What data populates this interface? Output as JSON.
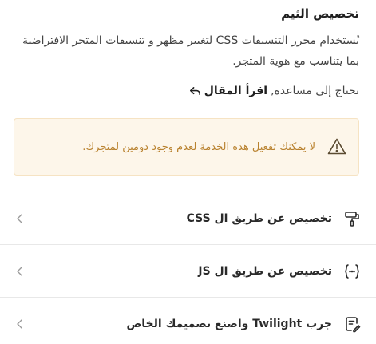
{
  "header": {
    "title": "تخصيص الثيم",
    "description": "يُستخدام محرر التنسيقات CSS لتغيير مظهر و تنسيقات المتجر الافتراضية بما يتناسب مع هوية المتجر."
  },
  "help": {
    "prefix": "تحتاج إلى مساعدة,",
    "link_label": "اقرأ المقال"
  },
  "alert": {
    "message": "لا يمكنك تفعيل هذه الخدمة لعدم وجود دومين لمتجرك."
  },
  "options": [
    {
      "label": "تخصيص عن طريق ال CSS",
      "icon": "paint-roller-icon"
    },
    {
      "label": "تخصيص عن طريق ال JS",
      "icon": "code-braces-icon"
    },
    {
      "label": "جرب Twilight واصنع تصميمك الخاص",
      "icon": "document-design-icon"
    }
  ],
  "colors": {
    "alert_bg": "#fdf6ea",
    "alert_text": "#b9822f"
  }
}
